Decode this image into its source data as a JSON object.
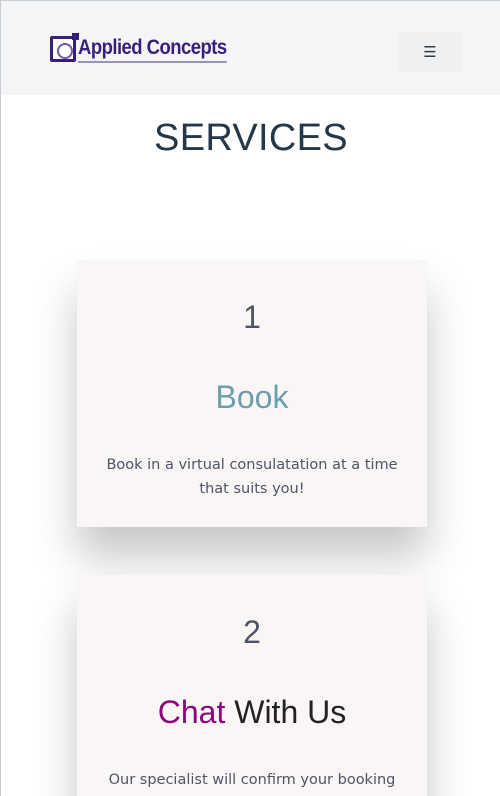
{
  "header": {
    "logo_text": "Applied Concepts",
    "menu_icon": "☰",
    "menu_icon_name": "hamburger-menu-icon"
  },
  "main": {
    "title": "SERVICES",
    "cards": [
      {
        "number": "1",
        "title": "Book",
        "text": "Book in a virtual consulatation at a time that suits you!"
      },
      {
        "number": "2",
        "title_accent": "Chat",
        "title_rest": " With Us",
        "text": "Our specialist will confirm your booking"
      }
    ]
  },
  "colors": {
    "header_bg": "#f4f5f7",
    "brand": "#3a1f7a",
    "card_bg": "#f9f6f5",
    "title": "#233848",
    "book_title": "#6b9fad",
    "chat_accent": "#8a087e"
  }
}
